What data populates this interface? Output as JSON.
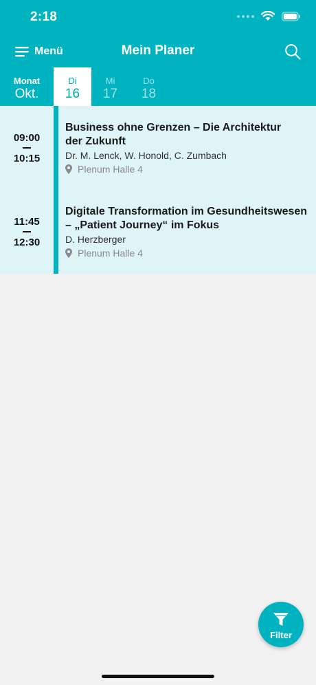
{
  "status_bar": {
    "time": "2:18"
  },
  "nav": {
    "menu_label": "Menü",
    "title": "Mein Planer"
  },
  "calendar": {
    "month_label": "Monat",
    "month_value": "Okt.",
    "days": [
      {
        "weekday": "Di",
        "day": "16",
        "active": true
      },
      {
        "weekday": "Mi",
        "day": "17",
        "active": false
      },
      {
        "weekday": "Do",
        "day": "18",
        "active": false
      }
    ]
  },
  "sessions": [
    {
      "start": "09:00",
      "end": "10:15",
      "title_line1": "Business ohne Grenzen – Die Architektur",
      "title_line2": "der Zukunft",
      "speakers": "Dr. M. Lenck, W. Honold, C. Zumbach",
      "location": "Plenum Halle 4"
    },
    {
      "start": "11:45",
      "end": "12:30",
      "title_line1": "Digitale Transformation im Gesundheitswesen",
      "title_line2": "– „Patient Journey“ im Fokus",
      "speakers": "D. Herzberger",
      "location": "Plenum Halle 4"
    }
  ],
  "filter_button": {
    "label": "Filter"
  },
  "colors": {
    "primary": "#00b3c1",
    "session_bg": "#def4f6",
    "page_bg": "#f2f2f2"
  }
}
